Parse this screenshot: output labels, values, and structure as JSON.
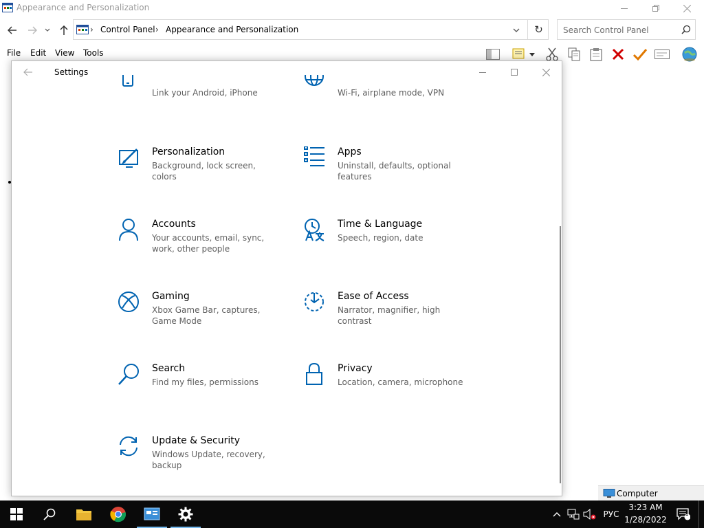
{
  "explorer": {
    "title": "Appearance and Personalization",
    "breadcrumb": [
      "Control Panel",
      "Appearance and Personalization"
    ],
    "search_placeholder": "Search Control Panel",
    "menu": [
      "File",
      "Edit",
      "View",
      "Tools"
    ],
    "status_text": "Computer"
  },
  "settings": {
    "title": "Settings",
    "tiles": [
      {
        "title": "",
        "desc": "Link your Android, iPhone",
        "icon": "phone-icon"
      },
      {
        "title": "",
        "desc": "Wi-Fi, airplane mode, VPN",
        "icon": "globe-icon"
      },
      {
        "title": "Personalization",
        "desc": "Background, lock screen, colors",
        "icon": "personalization-icon"
      },
      {
        "title": "Apps",
        "desc": "Uninstall, defaults, optional features",
        "icon": "apps-icon"
      },
      {
        "title": "Accounts",
        "desc": "Your accounts, email, sync, work, other people",
        "icon": "person-icon"
      },
      {
        "title": "Time & Language",
        "desc": "Speech, region, date",
        "icon": "time-language-icon"
      },
      {
        "title": "Gaming",
        "desc": "Xbox Game Bar, captures, Game Mode",
        "icon": "xbox-icon"
      },
      {
        "title": "Ease of Access",
        "desc": "Narrator, magnifier, high contrast",
        "icon": "ease-of-access-icon"
      },
      {
        "title": "Search",
        "desc": "Find my files, permissions",
        "icon": "search-icon"
      },
      {
        "title": "Privacy",
        "desc": "Location, camera, microphone",
        "icon": "lock-icon"
      },
      {
        "title": "Update & Security",
        "desc": "Windows Update, recovery, backup",
        "icon": "sync-icon"
      }
    ]
  },
  "taskbar": {
    "language": "РУС",
    "time": "3:23 AM",
    "date": "1/28/2022",
    "notification_count": "1"
  },
  "colors": {
    "accent": "#0063b1",
    "desc_gray": "#5f5f5f",
    "taskbar": "#0a0a0a"
  }
}
